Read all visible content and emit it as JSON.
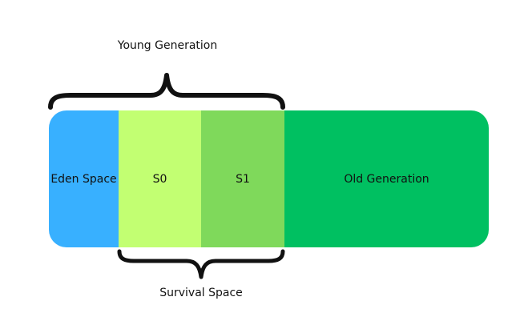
{
  "diagram": {
    "young_generation_label": "Young Generation",
    "survival_space_label": "Survival Space",
    "segments": {
      "eden": {
        "label": "Eden Space",
        "color": "#38b0ff"
      },
      "s0": {
        "label": "S0",
        "color": "#c2ff72"
      },
      "s1": {
        "label": "S1",
        "color": "#7fd95b"
      },
      "old": {
        "label": "Old Generation",
        "color": "#00c061"
      }
    },
    "brace_color": "#111111"
  }
}
